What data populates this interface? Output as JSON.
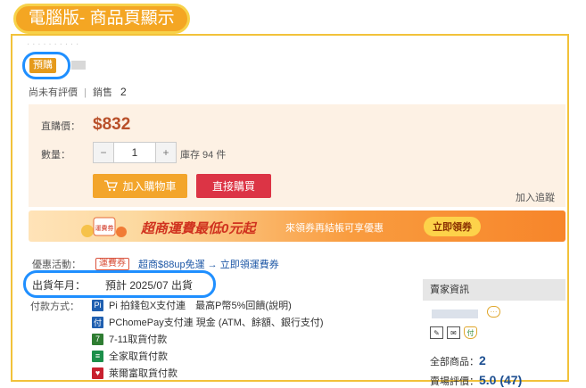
{
  "header": {
    "title": "電腦版- 商品頁顯示"
  },
  "product": {
    "preorder_tag": "預購",
    "rating_text": "尚未有評價",
    "separator": "|",
    "sales_label": "銷售",
    "sales_value": "2"
  },
  "purchase": {
    "price_label": "直購價：",
    "price": "$832",
    "quantity_label": "數量：",
    "minus": "−",
    "quantity_value": "1",
    "plus": "+",
    "stock_text": "庫存 94 件",
    "add_to_cart": "加入購物車",
    "buy_now": "直接購買",
    "add_to_track": "加入追蹤"
  },
  "banner": {
    "coupon_tag": "運費券",
    "headline": "超商運費最低0元起",
    "subtext": "來領券再結帳可享優惠",
    "button": "立即領券"
  },
  "promo": {
    "label": "優惠活動：",
    "badge": "運費券",
    "link_text": "超商$88up免運 → 立即領運費券"
  },
  "shipping": {
    "label": "出貨年月：",
    "value": "預計 2025/07 出貨"
  },
  "payment": {
    "label": "付款方式：",
    "methods": [
      {
        "icon": "pi-icon",
        "text": "Pi 拍錢包X支付連　最高P幣5%回饋(說明)"
      },
      {
        "icon": "pchomepay-icon",
        "text": "PChomePay支付連 現金 (ATM、餘額、銀行支付)"
      },
      {
        "icon": "seven-eleven-icon",
        "text": "7-11取貨付款"
      },
      {
        "icon": "familymart-icon",
        "text": "全家取貨付款"
      },
      {
        "icon": "hilife-icon",
        "text": "萊爾富取貨付款"
      }
    ],
    "colors": [
      "#1f5fb0",
      "#1f5fb0",
      "#2f7d32",
      "#1c8f4a",
      "#c8202f"
    ]
  },
  "seller": {
    "header": "賣家資訊",
    "all_products_label": "全部商品：",
    "all_products_value": "2",
    "rating_label": "賣場評價：",
    "rating_value": "5.0 (47)"
  },
  "colors": {
    "accent": "#f4a623",
    "highlight_ring": "#1f8fff",
    "price": "#b9502a",
    "buy": "#dc3445"
  }
}
